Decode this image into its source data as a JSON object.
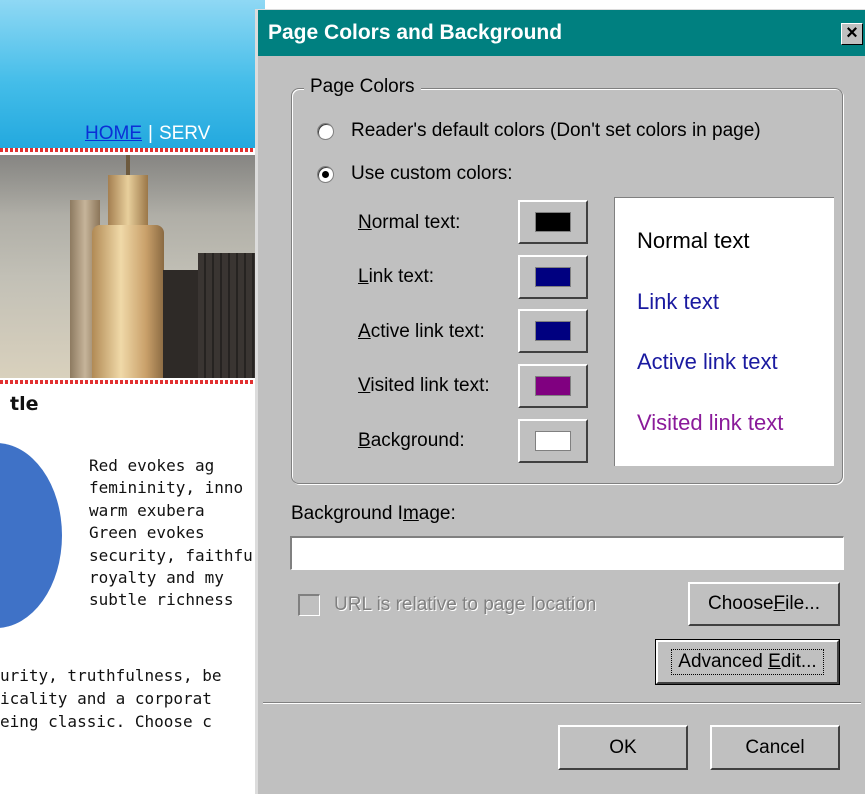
{
  "background_page": {
    "nav": {
      "home": "HOME",
      "separator": "|",
      "services": "SERV"
    },
    "heading": "tle",
    "paragraph_lines": [
      "Red evokes ag",
      "femininity, inno",
      "warm exubera",
      "Green evokes",
      "security, faithfu",
      "royalty and my",
      "subtle richness"
    ],
    "paragraph2_lines": [
      "urity, truthfulness, be",
      "icality and a corporat",
      "eing classic. Choose c"
    ]
  },
  "dialog": {
    "title": "Page Colors and Background",
    "close_label": "×",
    "page_colors": {
      "group_label": "Page Colors",
      "radio_default": {
        "label": "Reader's default colors (Don't set colors in page)",
        "checked": false
      },
      "radio_custom": {
        "label": "Use custom colors:",
        "checked": true
      },
      "colors": [
        {
          "key_char": "N",
          "label_rest": "ormal text:",
          "color": "#000000"
        },
        {
          "key_char": "L",
          "label_rest": "ink text:",
          "color": "#000080"
        },
        {
          "key_char": "A",
          "label_rest": "ctive link text:",
          "color": "#000080"
        },
        {
          "key_char": "V",
          "label_rest": "isited link text:",
          "color": "#800080"
        },
        {
          "key_char": "B",
          "label_rest": "ackground:",
          "color": "#ffffff"
        }
      ],
      "preview": {
        "normal": {
          "text": "Normal text",
          "color": "#000000"
        },
        "link": {
          "text": "Link text",
          "color": "#1a1aa0"
        },
        "active": {
          "text": "Active link text",
          "color": "#1a1aa0"
        },
        "visited": {
          "text": "Visited link text",
          "color": "#8a1a9a"
        }
      }
    },
    "background_image": {
      "label_before": "Background I",
      "label_key": "m",
      "label_after": "age:",
      "value": "",
      "relative_checkbox_label": "URL is relative to page location",
      "relative_checked": false,
      "choose_file_before": "Choose ",
      "choose_file_key": "F",
      "choose_file_after": "ile...",
      "advanced_edit_before": "Advanced ",
      "advanced_edit_key": "E",
      "advanced_edit_after": "dit..."
    },
    "ok_label": "OK",
    "cancel_label": "Cancel"
  }
}
